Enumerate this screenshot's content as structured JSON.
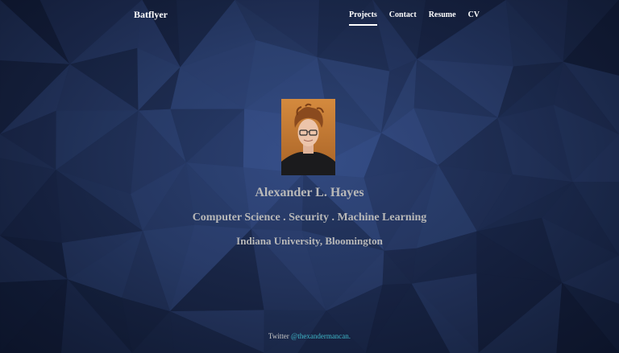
{
  "header": {
    "brand": "Batflyer",
    "nav": [
      {
        "label": "Projects",
        "active": true
      },
      {
        "label": "Contact",
        "active": false
      },
      {
        "label": "Resume",
        "active": false
      },
      {
        "label": "CV",
        "active": false
      }
    ]
  },
  "profile": {
    "name": "Alexander L. Hayes",
    "tagline": "Computer Science . Security . Machine Learning",
    "institution": "Indiana University, Bloomington"
  },
  "footer": {
    "prefix": "Twitter",
    "handle": "@thexandermancan."
  },
  "colors": {
    "background": "#24345c",
    "text_muted": "#b8b8b8",
    "link": "#3fb8c9",
    "nav_text": "#ffffff"
  }
}
